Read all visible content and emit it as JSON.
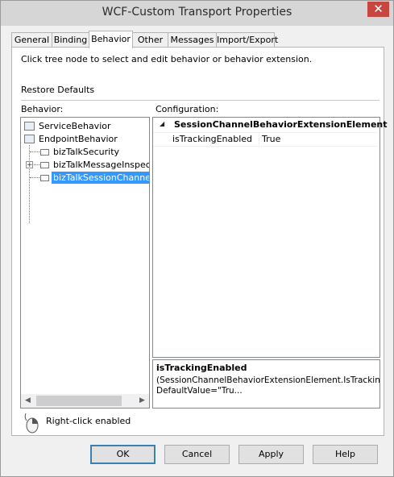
{
  "window": {
    "title": "WCF-Custom Transport Properties",
    "close_glyph": "✕"
  },
  "tabs": [
    {
      "label": "General"
    },
    {
      "label": "Binding"
    },
    {
      "label": "Behavior"
    },
    {
      "label": "Other"
    },
    {
      "label": "Messages"
    },
    {
      "label": "Import/Export"
    }
  ],
  "panel": {
    "instructions": "Click tree node to select and edit behavior or behavior extension.",
    "restore_defaults": "Restore Defaults",
    "behavior_label": "Behavior:",
    "configuration_label": "Configuration:"
  },
  "tree": {
    "items": [
      {
        "label": "ServiceBehavior"
      },
      {
        "label": "EndpointBehavior"
      },
      {
        "label": "bizTalkSecurity"
      },
      {
        "label": "bizTalkMessageInspecto"
      },
      {
        "label": "bizTalkSessionChannel"
      }
    ],
    "selected_index": 4
  },
  "property_grid": {
    "category": "SessionChannelBehaviorExtensionElement",
    "rows": [
      {
        "name": "isTrackingEnabled",
        "value": "True"
      }
    ],
    "description_title": "isTrackingEnabled",
    "description_text": "(SessionChannelBehaviorExtensionElement.IsTrackingEnabled)Name=\"isTrackingEnabled\" DefaultValue=\"Tru..."
  },
  "right_click": {
    "label": "Right-click enabled"
  },
  "buttons": {
    "ok": "OK",
    "cancel": "Cancel",
    "apply": "Apply",
    "help": "Help"
  },
  "colors": {
    "selection": "#3399ff",
    "close_button": "#c7463f"
  }
}
